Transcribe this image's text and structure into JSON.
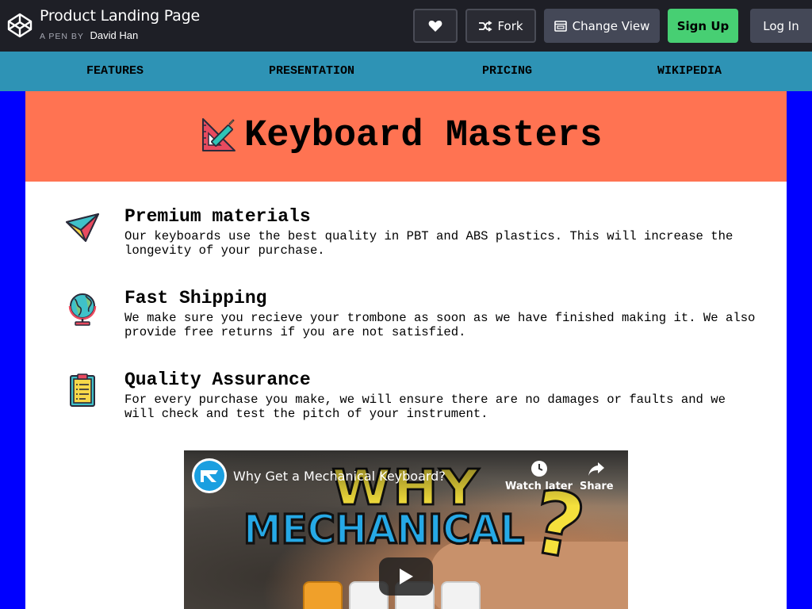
{
  "codepen": {
    "title": "Product Landing Page",
    "byline_prefix": "A PEN BY",
    "author": "David Han",
    "buttons": {
      "fork": "Fork",
      "change_view": "Change View",
      "sign_up": "Sign Up",
      "log_in": "Log In"
    },
    "icons": [
      "codepen-logo-icon",
      "heart-icon",
      "fork-icon",
      "change-view-icon"
    ]
  },
  "nav": {
    "items": [
      "FEATURES",
      "PRESENTATION",
      "PRICING",
      "WIKIPEDIA"
    ],
    "color": "#2e93b5"
  },
  "hero": {
    "title": "Keyboard Masters",
    "icon": "ruler-triangle-icon",
    "color": "#ff7352"
  },
  "features": [
    {
      "title": "Premium materials",
      "text": "Our keyboards use the best quality in PBT and ABS plastics. This will increase the longevity of your purchase.",
      "icon": "paper-plane-icon"
    },
    {
      "title": "Fast Shipping",
      "text": "We make sure you recieve your trombone as soon as we have finished making it. We also provide free returns if you are not satisfied.",
      "icon": "globe-icon"
    },
    {
      "title": "Quality Assurance",
      "text": "For every purchase you make, we will ensure there are no damages or faults and we will check and test the pitch of your instrument.",
      "icon": "clipboard-icon"
    }
  ],
  "video": {
    "title": "Why Get a Mechanical Keyboard?",
    "watch_later": "Watch later",
    "share": "Share",
    "thumb_line1": "WHY",
    "thumb_line2": "MECHANICAL",
    "thumb_mark": "?"
  },
  "colors": {
    "page_bg": "#0000ff",
    "codepen_bar": "#1e1f26",
    "sign_up": "#47cf73"
  }
}
